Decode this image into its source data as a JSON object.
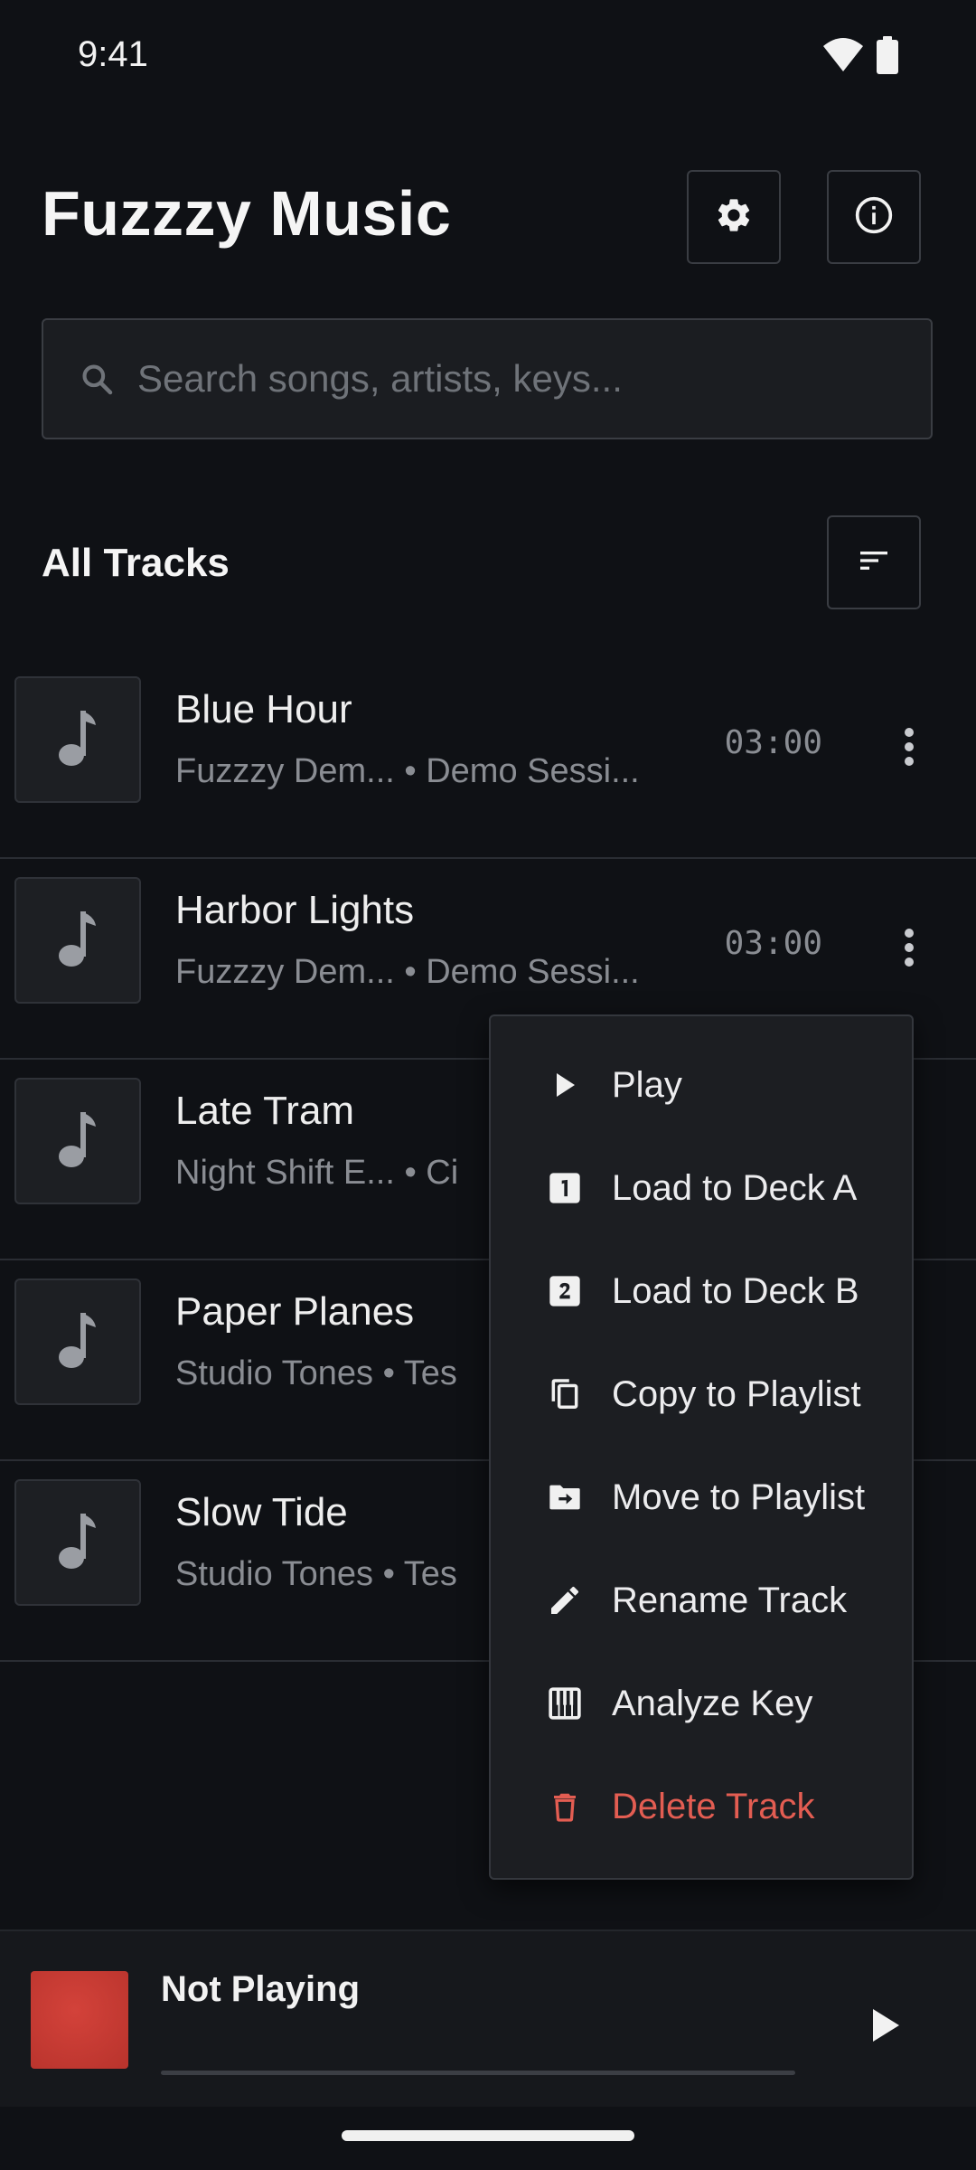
{
  "status_bar": {
    "time": "9:41"
  },
  "header": {
    "title": "Fuzzzy Music"
  },
  "search": {
    "placeholder": "Search songs, artists, keys..."
  },
  "section": {
    "title": "All Tracks"
  },
  "tracks": [
    {
      "title": "Blue Hour",
      "subtitle": "Fuzzzy Dem...  • Demo Sessi...",
      "duration": "03:00"
    },
    {
      "title": "Harbor Lights",
      "subtitle": "Fuzzzy Dem...  • Demo Sessi...",
      "duration": "03:00"
    },
    {
      "title": "Late Tram",
      "subtitle": "Night Shift E...  • Ci",
      "duration": ""
    },
    {
      "title": "Paper Planes",
      "subtitle": "Studio Tones • Tes",
      "duration": ""
    },
    {
      "title": "Slow Tide",
      "subtitle": "Studio Tones • Tes",
      "duration": ""
    }
  ],
  "context_menu": {
    "items": [
      {
        "label": "Play",
        "icon": "play-icon"
      },
      {
        "label": "Load to Deck A",
        "icon": "deck-1-icon"
      },
      {
        "label": "Load to Deck B",
        "icon": "deck-2-icon"
      },
      {
        "label": "Copy to Playlist",
        "icon": "copy-icon"
      },
      {
        "label": "Move to Playlist",
        "icon": "move-folder-icon"
      },
      {
        "label": "Rename Track",
        "icon": "pencil-icon"
      },
      {
        "label": "Analyze Key",
        "icon": "piano-icon"
      },
      {
        "label": "Delete Track",
        "icon": "trash-icon",
        "danger": true
      }
    ]
  },
  "mini_player": {
    "title": "Not Playing",
    "progress": 0
  },
  "colors": {
    "background": "#0f1115",
    "surface": "#1c1e22",
    "danger": "#e35d52",
    "album_art": "#c83a32"
  }
}
